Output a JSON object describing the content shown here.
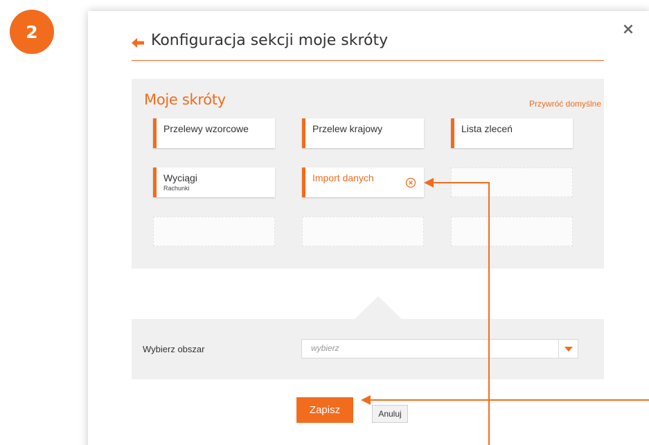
{
  "step_badge": "2",
  "modal": {
    "title": "Konfiguracja sekcji moje skróty",
    "close_icon": "×"
  },
  "shortcuts": {
    "title": "Moje skróty",
    "restore_label": "Przywróć domyślne",
    "tiles": [
      {
        "label": "Przelewy wzorcowe",
        "sub": ""
      },
      {
        "label": "Przelew krajowy",
        "sub": ""
      },
      {
        "label": "Lista zleceń",
        "sub": ""
      },
      {
        "label": "Wyciągi",
        "sub": "Rachunki"
      },
      {
        "label": "Import danych",
        "sub": "",
        "active": true
      }
    ],
    "empty_slots": 4
  },
  "area_select": {
    "label": "Wybierz obszar",
    "value": "wybierz"
  },
  "buttons": {
    "save": "Zapisz",
    "cancel": "Anuluj"
  },
  "colors": {
    "accent": "#f26c1d",
    "panel_bg": "#f0f0f0",
    "text": "#333333"
  }
}
